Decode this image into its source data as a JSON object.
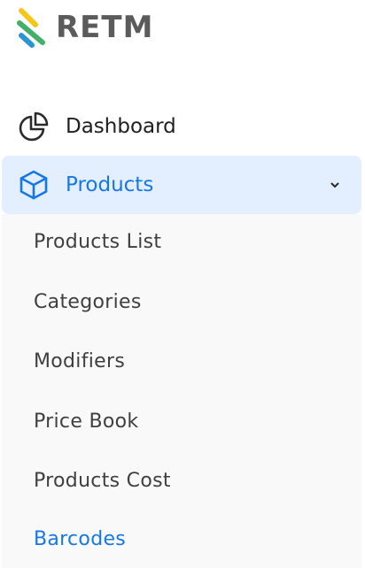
{
  "brand": {
    "name": "RETM",
    "logo_icon": "stripes-logo-icon",
    "colors": [
      "#f5c518",
      "#43b06a",
      "#2b94d6"
    ]
  },
  "nav": {
    "dashboard": {
      "label": "Dashboard",
      "icon": "pie-chart-icon"
    },
    "products": {
      "label": "Products",
      "icon": "cube-icon",
      "expanded": true,
      "chevron_icon": "chevron-down-icon",
      "sub_items": [
        {
          "label": "Products List",
          "active": false
        },
        {
          "label": "Categories",
          "active": false
        },
        {
          "label": "Modifiers",
          "active": false
        },
        {
          "label": "Price Book",
          "active": false
        },
        {
          "label": "Products Cost",
          "active": false
        },
        {
          "label": "Barcodes",
          "active": true
        }
      ]
    }
  },
  "theme": {
    "accent": "#1677e8",
    "active_bg": "#e3efff",
    "submenu_bg": "#f9f9f9",
    "text_primary": "#1f1f1f",
    "text_secondary": "#3f3f3f"
  }
}
